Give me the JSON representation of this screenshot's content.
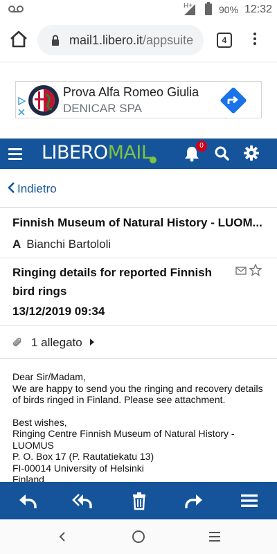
{
  "status_bar": {
    "network": "H+",
    "battery_percent": "90%",
    "time": "12:32",
    "icons": [
      "voicemail-icon",
      "signal-icon",
      "battery-icon"
    ]
  },
  "browser": {
    "url_host": "mail1.libero.it",
    "url_path": "/appsuite",
    "tab_count": "4",
    "icons": [
      "home-icon",
      "lock-icon",
      "tabs-icon",
      "overflow-menu-icon"
    ]
  },
  "ad": {
    "title": "Prova Alfa Romeo Giulia",
    "subtitle": "DENICAR SPA",
    "logo_text": "ALFA ROMEO",
    "icons": [
      "alfa-romeo-logo",
      "directions-arrow-icon",
      "adchoices-icon",
      "close-icon"
    ],
    "cta_color": "#1a73e8"
  },
  "header": {
    "brand_part1": "LIBERO",
    "brand_part2": "MAIL",
    "notification_count": "0",
    "colors": {
      "bar": "#15549a",
      "brand_green": "#7dc242",
      "badge": "#d0021b"
    },
    "icons": [
      "hamburger-icon",
      "bell-icon",
      "search-icon",
      "gear-icon"
    ]
  },
  "nav": {
    "back_label": "Indietro"
  },
  "message": {
    "sender": "Finnish Museum of Natural History - LUOMUS",
    "to_prefix": "A",
    "to_name": "Bianchi Bartololi",
    "subject": "Ringing details for reported Finnish bird rings",
    "datetime": "13/12/2019 09:34",
    "attachments_label": "1 allegato",
    "body": {
      "greeting": "Dear Sir/Madam,",
      "line1": "We are happy to send you the ringing and recovery details of birds ringed in Finland. Please see attachment.",
      "closing": "Best wishes,",
      "sig1": "Ringing Centre Finnish Museum of Natural History - LUOMUS",
      "sig2": "P. O. Box 17 (P. Rautatiekatu 13)",
      "sig3": "FI-00014 University of Helsinki",
      "sig4": "Finland"
    }
  },
  "toolbar": {
    "icons": [
      "reply-icon",
      "reply-all-icon",
      "trash-icon",
      "forward-icon",
      "more-menu-icon"
    ]
  },
  "android_nav": {
    "icons": [
      "nav-back-icon",
      "nav-home-icon",
      "nav-recents-icon"
    ]
  }
}
